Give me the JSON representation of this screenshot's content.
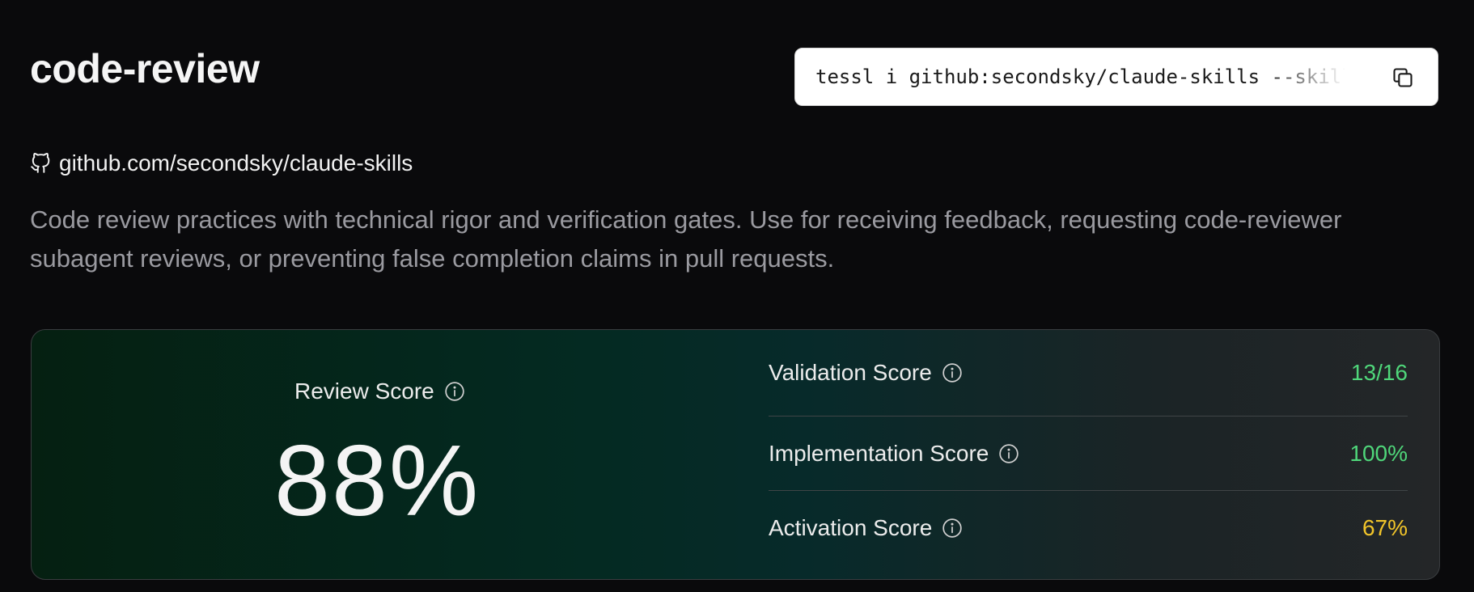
{
  "header": {
    "title": "code-review"
  },
  "install": {
    "command": "tessl i github:secondsky/claude-skills --skill code-review",
    "copy_icon": "copy-icon"
  },
  "repo": {
    "icon": "github-icon",
    "label": "github.com/secondsky/claude-skills"
  },
  "description": "Code review practices with technical rigor and verification gates. Use for receiving feedback, requesting code-reviewer subagent reviews, or preventing false completion claims in pull requests.",
  "scores": {
    "review": {
      "label": "Review Score",
      "value": "88%",
      "info_icon": "info-icon"
    },
    "metrics": [
      {
        "label": "Validation Score",
        "value": "13/16",
        "color": "#4fd67a"
      },
      {
        "label": "Implementation Score",
        "value": "100%",
        "color": "#4fd67a"
      },
      {
        "label": "Activation Score",
        "value": "67%",
        "color": "#f2c52a"
      }
    ]
  },
  "colors": {
    "background": "#0a0a0c",
    "good": "#4fd67a",
    "warn": "#f2c52a"
  }
}
